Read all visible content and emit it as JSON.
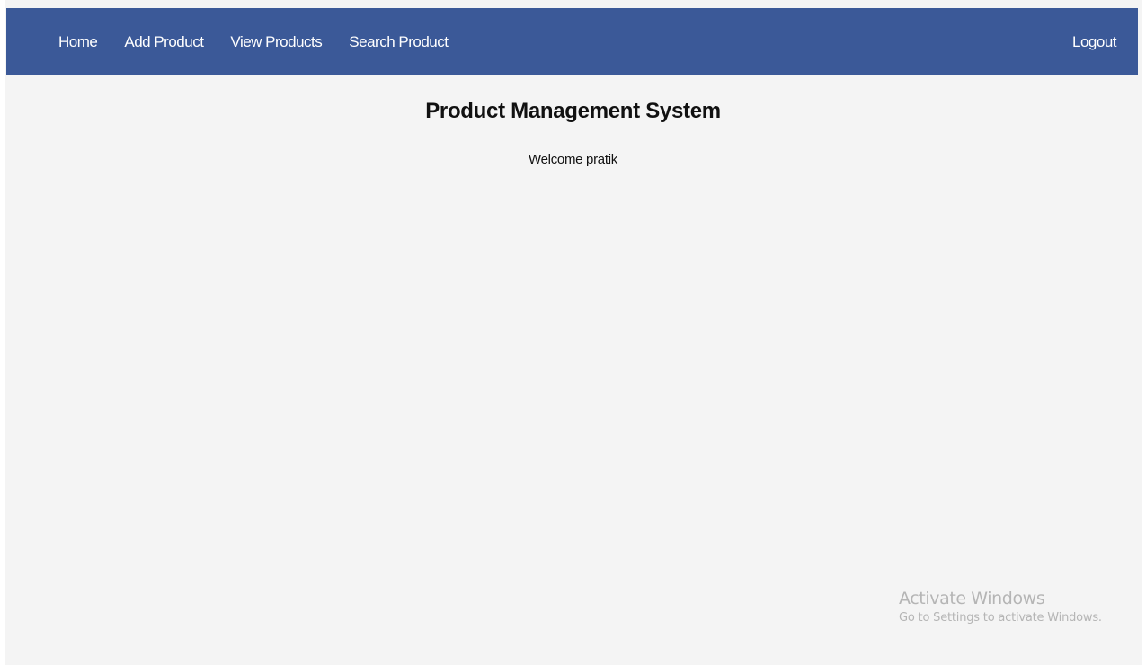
{
  "nav": {
    "items": [
      {
        "label": "Home"
      },
      {
        "label": "Add Product"
      },
      {
        "label": "View Products"
      },
      {
        "label": "Search Product"
      }
    ],
    "logout_label": "Logout"
  },
  "main": {
    "title": "Product Management System",
    "welcome": "Welcome pratik"
  },
  "watermark": {
    "title": "Activate Windows",
    "subtitle": "Go to Settings to activate Windows."
  },
  "colors": {
    "navbar_bg": "#3b5998",
    "page_bg": "#f4f4f4"
  }
}
